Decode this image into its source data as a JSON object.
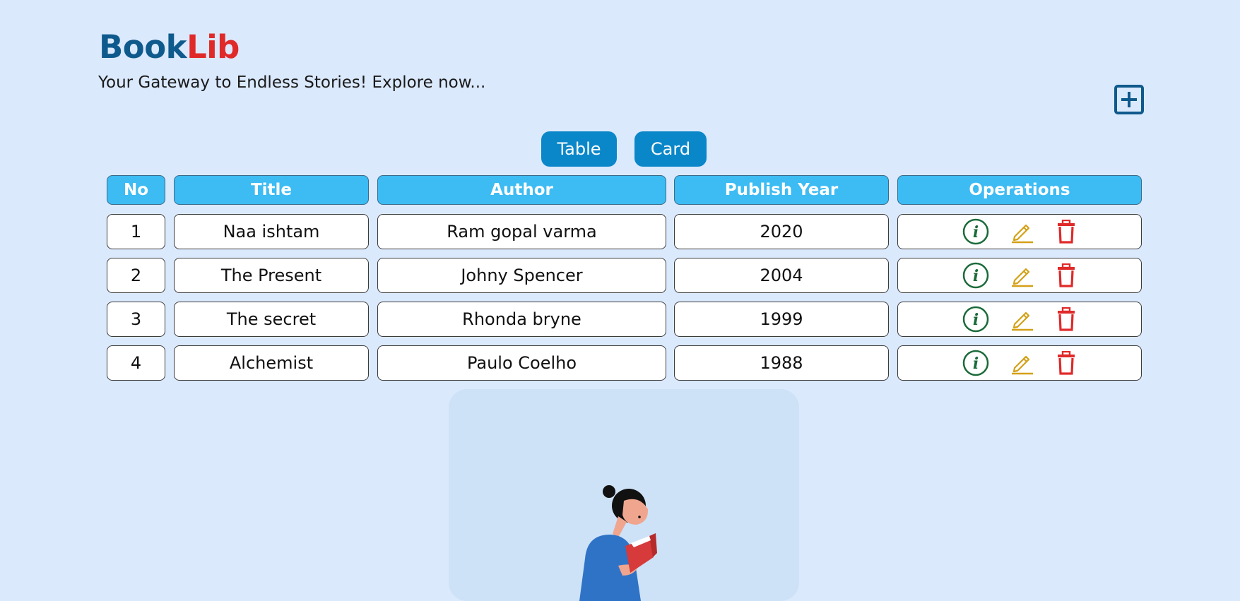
{
  "header": {
    "brand_part1": "Book",
    "brand_part2": "Lib",
    "tagline": "Your Gateway to Endless Stories! Explore now..."
  },
  "view_toggle": {
    "table_label": "Table",
    "card_label": "Card"
  },
  "table": {
    "columns": [
      "No",
      "Title",
      "Author",
      "Publish Year",
      "Operations"
    ],
    "rows": [
      {
        "no": "1",
        "title": "Naa ishtam",
        "author": "Ram gopal varma",
        "year": "2020"
      },
      {
        "no": "2",
        "title": "The Present",
        "author": "Johny Spencer",
        "year": "2004"
      },
      {
        "no": "3",
        "title": "The secret",
        "author": "Rhonda bryne",
        "year": "1999"
      },
      {
        "no": "4",
        "title": "Alchemist",
        "author": "Paulo Coelho",
        "year": "1988"
      }
    ]
  },
  "icons": {
    "add": "plus-square-icon",
    "info": "info-circle-icon",
    "edit": "pencil-icon",
    "delete": "trash-icon"
  },
  "colors": {
    "background": "#dbe9fd",
    "brand_blue": "#0f5a8c",
    "brand_red": "#e02a2a",
    "header_cell": "#3dbbf3",
    "toggle_button": "#0a87c9",
    "info_icon": "#1b6b3a",
    "edit_icon": "#d4a017",
    "delete_icon": "#e02a2a"
  }
}
